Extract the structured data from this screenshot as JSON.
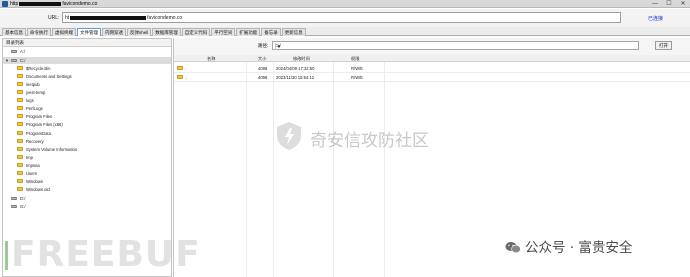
{
  "window": {
    "title_prefix": "http",
    "title_suffix": "favicondemo.co",
    "controls": [
      "—",
      "☐",
      "✕"
    ]
  },
  "urlbar": {
    "label": "URL:",
    "url_prefix": "ht",
    "url_suffix": "favicondemo.co",
    "status": "已连接"
  },
  "tabs": [
    "基本信息",
    "命令执行",
    "虚拟终端",
    "文件管理",
    "内网穿透",
    "反弹shell",
    "数据库管理",
    "自定义代码",
    "平行空间",
    "扩展功能",
    "备忘录",
    "更新信息"
  ],
  "active_tab": 3,
  "left_panel": {
    "header": "目录列表",
    "tree": [
      {
        "label": "A:/",
        "type": "drive",
        "depth": 0,
        "expander": ""
      },
      {
        "label": "C:/",
        "type": "drive",
        "depth": 0,
        "expander": "▼",
        "selected": true
      },
      {
        "label": "$Recycle.Bin",
        "type": "folder",
        "depth": 1
      },
      {
        "label": "Documents and Settings",
        "type": "folder",
        "depth": 1
      },
      {
        "label": "inetpub",
        "type": "folder",
        "depth": 1
      },
      {
        "label": "jvest-temp",
        "type": "folder",
        "depth": 1
      },
      {
        "label": "logs",
        "type": "folder",
        "depth": 1
      },
      {
        "label": "PerfLogs",
        "type": "folder",
        "depth": 1
      },
      {
        "label": "Program Files",
        "type": "folder",
        "depth": 1
      },
      {
        "label": "Program Files (x86)",
        "type": "folder",
        "depth": 1
      },
      {
        "label": "ProgramData",
        "type": "folder",
        "depth": 1
      },
      {
        "label": "Recovery",
        "type": "folder",
        "depth": 1
      },
      {
        "label": "System Volume Information",
        "type": "folder",
        "depth": 1
      },
      {
        "label": "tmp",
        "type": "folder",
        "depth": 1
      },
      {
        "label": "tmpsea",
        "type": "folder",
        "depth": 1
      },
      {
        "label": "Users",
        "type": "folder",
        "depth": 1
      },
      {
        "label": "Windows",
        "type": "folder",
        "depth": 1
      },
      {
        "label": "Windows.old",
        "type": "folder",
        "depth": 1
      },
      {
        "label": "D:/",
        "type": "drive",
        "depth": 0,
        "expander": ""
      },
      {
        "label": "G:/",
        "type": "drive",
        "depth": 0,
        "expander": ""
      }
    ]
  },
  "path_bar": {
    "label": "路径:",
    "value": "C:/",
    "dropdown": "▼",
    "open_button": "打开"
  },
  "file_table": {
    "columns": [
      "名称",
      "大小",
      "修改时间",
      "权限"
    ],
    "rows": [
      {
        "name": ".",
        "size": "4096",
        "modified": "2024/04/09 17:32:50",
        "perm": "R/W/E"
      },
      {
        "name": "..",
        "size": "4096",
        "modified": "2023/11/30 15:54:12",
        "perm": "R/W/E"
      }
    ]
  },
  "watermarks": {
    "center": "奇安信攻防社区",
    "freebuf": "FREEBUF",
    "wechat": "公众号 · 富贵安全"
  }
}
